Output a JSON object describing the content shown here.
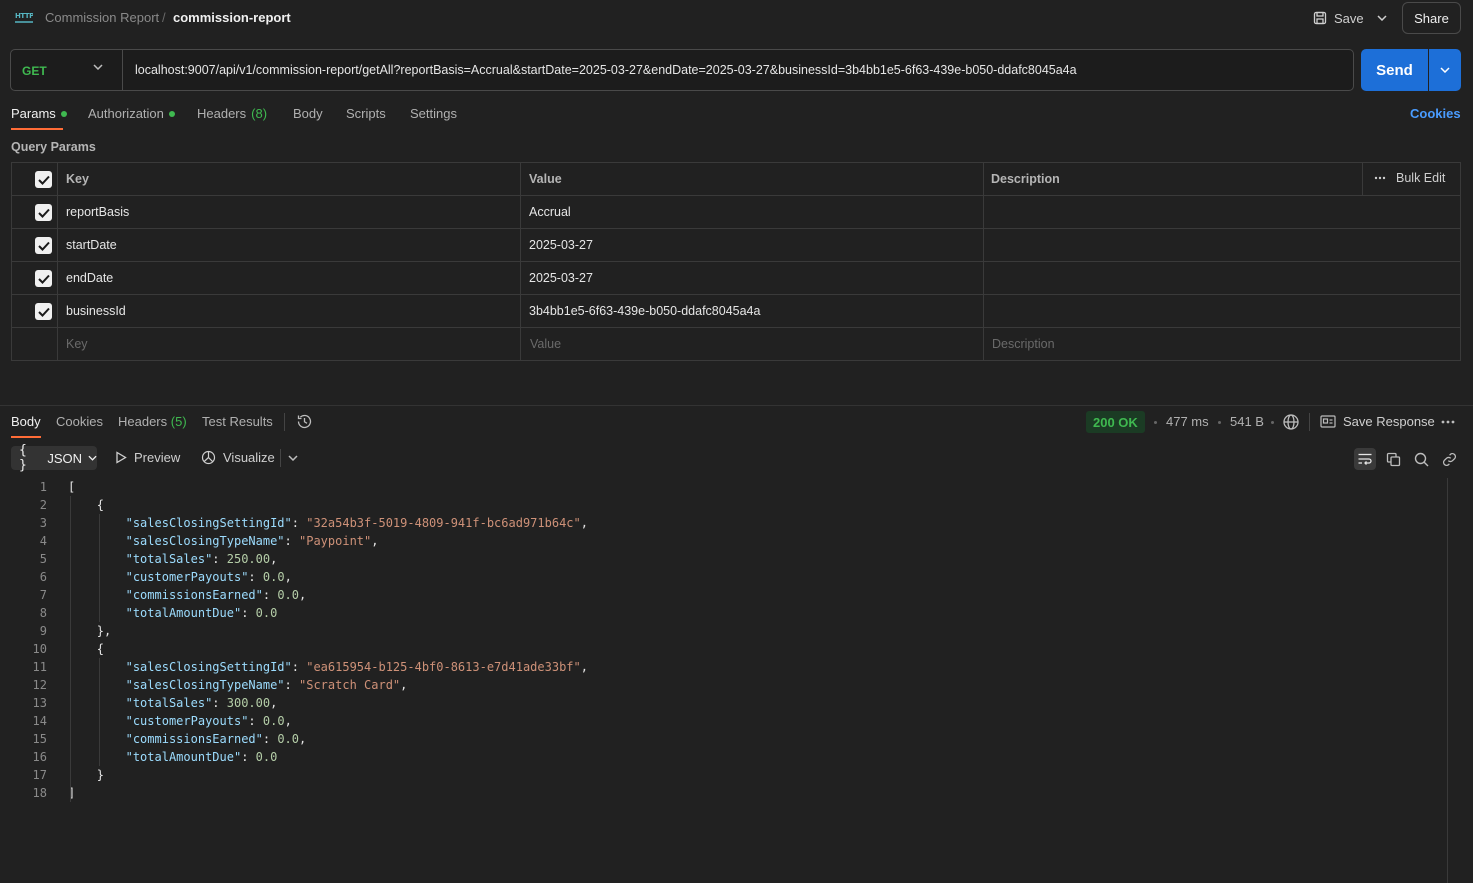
{
  "header": {
    "icon_text": "HTTP",
    "breadcrumb_parent": "Commission Report",
    "breadcrumb_sep": "/",
    "breadcrumb_current": "commission-report",
    "save_label": "Save",
    "share_label": "Share"
  },
  "request": {
    "method": "GET",
    "url": "localhost:9007/api/v1/commission-report/getAll?reportBasis=Accrual&startDate=2025-03-27&endDate=2025-03-27&businessId=3b4bb1e5-6f63-439e-b050-ddafc8045a4a",
    "send_label": "Send"
  },
  "req_tabs": {
    "params": "Params",
    "authorization": "Authorization",
    "headers": "Headers",
    "headers_count": "(8)",
    "body": "Body",
    "scripts": "Scripts",
    "settings": "Settings",
    "cookies": "Cookies"
  },
  "query_params": {
    "title": "Query Params",
    "headers": {
      "key": "Key",
      "value": "Value",
      "description": "Description",
      "bulk_edit": "Bulk Edit"
    },
    "rows": [
      {
        "key": "reportBasis",
        "value": "Accrual"
      },
      {
        "key": "startDate",
        "value": "2025-03-27"
      },
      {
        "key": "endDate",
        "value": "2025-03-27"
      },
      {
        "key": "businessId",
        "value": "3b4bb1e5-6f63-439e-b050-ddafc8045a4a"
      }
    ],
    "placeholders": {
      "key": "Key",
      "value": "Value",
      "description": "Description"
    }
  },
  "response": {
    "tabs": {
      "body": "Body",
      "cookies": "Cookies",
      "headers": "Headers",
      "headers_count": "(5)",
      "test_results": "Test Results"
    },
    "status": "200 OK",
    "time": "477 ms",
    "size": "541 B",
    "save_response": "Save Response",
    "format": "JSON",
    "preview": "Preview",
    "visualize": "Visualize",
    "lines": [
      {
        "n": "1",
        "indent": 0,
        "tokens": [
          {
            "t": "p",
            "v": "["
          }
        ]
      },
      {
        "n": "2",
        "indent": 1,
        "tokens": [
          {
            "t": "p",
            "v": "{"
          }
        ]
      },
      {
        "n": "3",
        "indent": 2,
        "tokens": [
          {
            "t": "k",
            "v": "\"salesClosingSettingId\""
          },
          {
            "t": "p",
            "v": ": "
          },
          {
            "t": "s",
            "v": "\"32a54b3f-5019-4809-941f-bc6ad971b64c\""
          },
          {
            "t": "p",
            "v": ","
          }
        ]
      },
      {
        "n": "4",
        "indent": 2,
        "tokens": [
          {
            "t": "k",
            "v": "\"salesClosingTypeName\""
          },
          {
            "t": "p",
            "v": ": "
          },
          {
            "t": "s",
            "v": "\"Paypoint\""
          },
          {
            "t": "p",
            "v": ","
          }
        ]
      },
      {
        "n": "5",
        "indent": 2,
        "tokens": [
          {
            "t": "k",
            "v": "\"totalSales\""
          },
          {
            "t": "p",
            "v": ": "
          },
          {
            "t": "n",
            "v": "250.00"
          },
          {
            "t": "p",
            "v": ","
          }
        ]
      },
      {
        "n": "6",
        "indent": 2,
        "tokens": [
          {
            "t": "k",
            "v": "\"customerPayouts\""
          },
          {
            "t": "p",
            "v": ": "
          },
          {
            "t": "n",
            "v": "0.0"
          },
          {
            "t": "p",
            "v": ","
          }
        ]
      },
      {
        "n": "7",
        "indent": 2,
        "tokens": [
          {
            "t": "k",
            "v": "\"commissionsEarned\""
          },
          {
            "t": "p",
            "v": ": "
          },
          {
            "t": "n",
            "v": "0.0"
          },
          {
            "t": "p",
            "v": ","
          }
        ]
      },
      {
        "n": "8",
        "indent": 2,
        "tokens": [
          {
            "t": "k",
            "v": "\"totalAmountDue\""
          },
          {
            "t": "p",
            "v": ": "
          },
          {
            "t": "n",
            "v": "0.0"
          }
        ]
      },
      {
        "n": "9",
        "indent": 1,
        "tokens": [
          {
            "t": "p",
            "v": "},"
          }
        ]
      },
      {
        "n": "10",
        "indent": 1,
        "tokens": [
          {
            "t": "p",
            "v": "{"
          }
        ]
      },
      {
        "n": "11",
        "indent": 2,
        "tokens": [
          {
            "t": "k",
            "v": "\"salesClosingSettingId\""
          },
          {
            "t": "p",
            "v": ": "
          },
          {
            "t": "s",
            "v": "\"ea615954-b125-4bf0-8613-e7d41ade33bf\""
          },
          {
            "t": "p",
            "v": ","
          }
        ]
      },
      {
        "n": "12",
        "indent": 2,
        "tokens": [
          {
            "t": "k",
            "v": "\"salesClosingTypeName\""
          },
          {
            "t": "p",
            "v": ": "
          },
          {
            "t": "s",
            "v": "\"Scratch Card\""
          },
          {
            "t": "p",
            "v": ","
          }
        ]
      },
      {
        "n": "13",
        "indent": 2,
        "tokens": [
          {
            "t": "k",
            "v": "\"totalSales\""
          },
          {
            "t": "p",
            "v": ": "
          },
          {
            "t": "n",
            "v": "300.00"
          },
          {
            "t": "p",
            "v": ","
          }
        ]
      },
      {
        "n": "14",
        "indent": 2,
        "tokens": [
          {
            "t": "k",
            "v": "\"customerPayouts\""
          },
          {
            "t": "p",
            "v": ": "
          },
          {
            "t": "n",
            "v": "0.0"
          },
          {
            "t": "p",
            "v": ","
          }
        ]
      },
      {
        "n": "15",
        "indent": 2,
        "tokens": [
          {
            "t": "k",
            "v": "\"commissionsEarned\""
          },
          {
            "t": "p",
            "v": ": "
          },
          {
            "t": "n",
            "v": "0.0"
          },
          {
            "t": "p",
            "v": ","
          }
        ]
      },
      {
        "n": "16",
        "indent": 2,
        "tokens": [
          {
            "t": "k",
            "v": "\"totalAmountDue\""
          },
          {
            "t": "p",
            "v": ": "
          },
          {
            "t": "n",
            "v": "0.0"
          }
        ]
      },
      {
        "n": "17",
        "indent": 1,
        "tokens": [
          {
            "t": "p",
            "v": "}"
          }
        ]
      },
      {
        "n": "18",
        "indent": 0,
        "tokens": [
          {
            "t": "p",
            "v": "]"
          }
        ]
      }
    ]
  },
  "colors": {
    "accent_orange": "#ff6c37",
    "send_blue": "#1d6fd8",
    "success_green": "#3fb950",
    "background": "#212121"
  },
  "icons": [
    "http-icon",
    "save-icon",
    "chevron-down-icon",
    "checkbox-icon",
    "more-icon",
    "history-icon",
    "globe-icon",
    "save-response-icon",
    "preview-icon",
    "visualize-icon",
    "wrap-icon",
    "copy-icon",
    "search-icon",
    "link-icon"
  ]
}
